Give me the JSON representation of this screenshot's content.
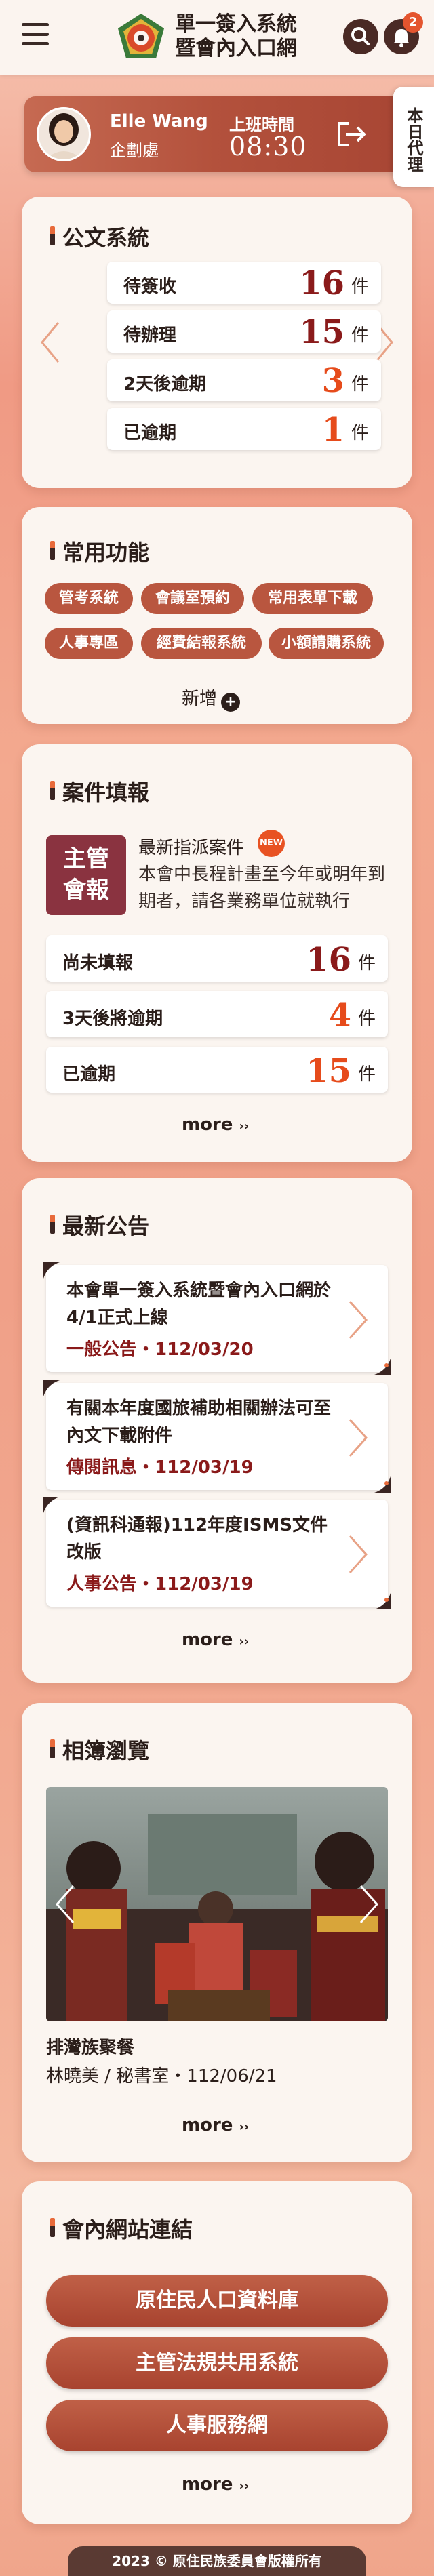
{
  "header": {
    "title_line1": "單一簽入系統",
    "title_line2": "暨會內入口網",
    "notification_count": "2"
  },
  "user": {
    "name": "Elle Wang",
    "department": "企劃處",
    "work_label": "上班時間",
    "work_time": "08:30"
  },
  "side_tab": {
    "label": "本日代理"
  },
  "documents": {
    "title": "公文系統",
    "rows": [
      {
        "label": "待簽收",
        "count": "16",
        "unit": "件"
      },
      {
        "label": "待辦理",
        "count": "15",
        "unit": "件"
      },
      {
        "label": "2天後逾期",
        "count": "3",
        "unit": "件"
      },
      {
        "label": "已逾期",
        "count": "1",
        "unit": "件"
      }
    ]
  },
  "functions": {
    "title": "常用功能",
    "chips": [
      "管考系統",
      "會議室預約",
      "常用表單下載",
      "人事專區",
      "經費結報系統",
      "小額請購系統"
    ],
    "add_label": "新增"
  },
  "cases": {
    "title": "案件填報",
    "box_line1": "主管",
    "box_line2": "會報",
    "head": "最新指派案件",
    "new_badge": "NEW",
    "desc": "本會中長程計畫至今年或明年到期者，請各業務單位就執行",
    "rows": [
      {
        "label": "尚未填報",
        "count": "16",
        "unit": "件"
      },
      {
        "label": "3天後將逾期",
        "count": "4",
        "unit": "件"
      },
      {
        "label": "已逾期",
        "count": "15",
        "unit": "件"
      }
    ],
    "more": "more"
  },
  "news": {
    "title": "最新公告",
    "items": [
      {
        "title": "本會單一簽入系統暨會內入口網於4/1正式上線",
        "category": "一般公告",
        "date": "112/03/20"
      },
      {
        "title": "有關本年度國旅補助相關辦法可至內文下載附件",
        "category": "傳閱訊息",
        "date": "112/03/19"
      },
      {
        "title": "(資訊科通報)112年度ISMS文件改版",
        "category": "人事公告",
        "date": "112/03/19"
      }
    ],
    "more": "more"
  },
  "album": {
    "title": "相簿瀏覽",
    "photo_title": "排灣族聚餐",
    "photo_meta": "林曉美 / 秘書室・112/06/21",
    "more": "more"
  },
  "links": {
    "title": "會內網站連結",
    "items": [
      "原住民人口資料庫",
      "主管法規共用系統",
      "人事服務網"
    ],
    "more": "more"
  },
  "footer": {
    "text": "2023 © 原住民族委員會版權所有"
  },
  "colors": {
    "accent": "#b9563f",
    "dark_red": "#8a1a1a",
    "orange": "#e64b1b"
  }
}
